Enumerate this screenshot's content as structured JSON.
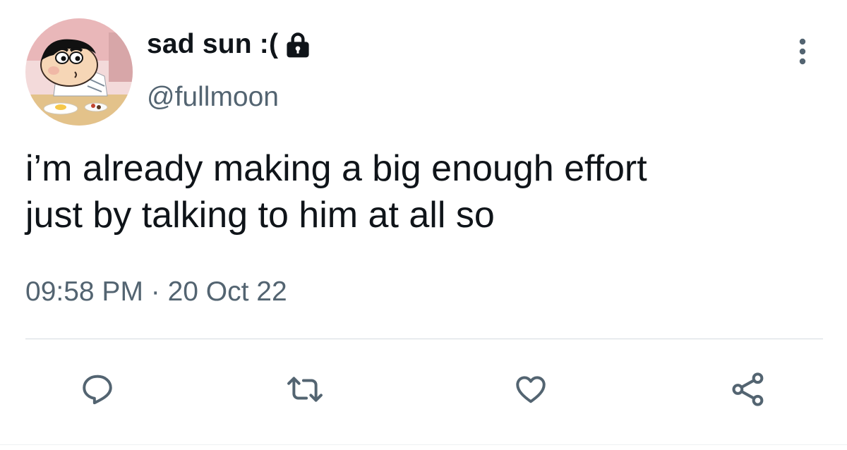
{
  "user": {
    "display_name": "sad sun :(",
    "handle": "@fullmoon",
    "protected": true,
    "avatar_icon": "cartoon-boy-avatar"
  },
  "menu_icon": "more-vertical-icon",
  "tweet": {
    "text": "i’m already making a big enough effort\njust by talking to him at all so",
    "timestamp": "09:58 PM · 20 Oct 22"
  },
  "actions": [
    {
      "name": "reply",
      "icon": "reply-icon"
    },
    {
      "name": "retweet",
      "icon": "retweet-icon"
    },
    {
      "name": "like",
      "icon": "heart-icon"
    },
    {
      "name": "share",
      "icon": "share-icon"
    }
  ],
  "colors": {
    "text_primary": "#0f1419",
    "text_secondary": "#536471",
    "icon": "#536471",
    "divider": "#d4dadf"
  }
}
